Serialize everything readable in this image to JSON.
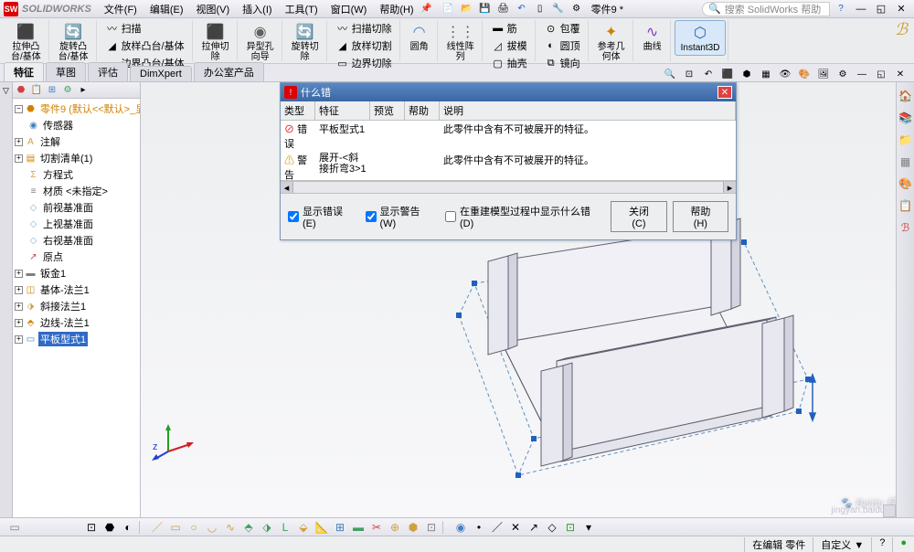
{
  "app": {
    "logo_text": "SW",
    "name": "SOLIDWORKS",
    "doc_name": "零件9 *"
  },
  "menu": {
    "file": "文件(F)",
    "edit": "编辑(E)",
    "view": "视图(V)",
    "insert": "插入(I)",
    "tools": "工具(T)",
    "window": "窗口(W)",
    "help": "帮助(H)"
  },
  "search": {
    "placeholder": "搜索 SolidWorks 帮助"
  },
  "ribbon": {
    "extrude_boss": "拉伸凸\n台/基体",
    "revolve_boss": "旋转凸\n台/基体",
    "sweep": "扫描",
    "loft": "放样凸台/基体",
    "boundary": "边界凸台/基体",
    "ext_cut": "拉伸切\n除",
    "hole": "异型孔\n向导",
    "rev_cut": "旋转切\n除",
    "sweep_cut": "扫描切除",
    "loft_cut": "放样切割",
    "boundary_cut": "边界切除",
    "fillet": "圆角",
    "pattern": "线性阵\n列",
    "rib": "筋",
    "draft": "拔模",
    "shell": "抽壳",
    "wrap": "包覆",
    "dome": "圆顶",
    "mirror": "镜向",
    "refgeo": "参考几\n何体",
    "curves": "曲线",
    "instant3d": "Instant3D"
  },
  "tabs": {
    "features": "特征",
    "sketch": "草图",
    "evaluate": "评估",
    "dimxpert": "DimXpert",
    "office": "办公室产品"
  },
  "tree": {
    "root": "零件9  (默认<<默认>_显示状",
    "sensors": "传感器",
    "annotations": "注解",
    "cutlist": "切割清单(1)",
    "equations": "方程式",
    "material": "材质 <未指定>",
    "front": "前视基准面",
    "top": "上视基准面",
    "right": "右视基准面",
    "origin": "原点",
    "sheetmetal": "钣金1",
    "baseflange": "基体-法兰1",
    "miterflange": "斜接法兰1",
    "edgeflange": "边线-法兰1",
    "flatpattern": "平板型式1"
  },
  "dialog": {
    "title": "什么错",
    "col_type": "类型",
    "col_feat": "特征",
    "col_preview": "预览",
    "col_help": "帮助",
    "col_desc": "说明",
    "row1_type": "错误",
    "row1_feat": "平板型式1",
    "row1_desc": "此零件中含有不可被展开的特征。",
    "row2_type": "警告",
    "row2_feat": "展开-<斜接折弯3>1",
    "row2_desc": "此零件中含有不可被展开的特征。",
    "chk_err": "显示错误(E)",
    "chk_warn": "显示警告(W)",
    "chk_rebuild": "在重建模型过程中显示什么错(D)",
    "btn_close": "关闭(C)",
    "btn_help": "帮助(H)"
  },
  "status": {
    "editing": "在编辑 零件",
    "custom": "自定义 ▼"
  },
  "watermark": {
    "text": "Baidu 经验",
    "url": "jingyan.baidu.com"
  },
  "triad": {
    "z": "z"
  }
}
